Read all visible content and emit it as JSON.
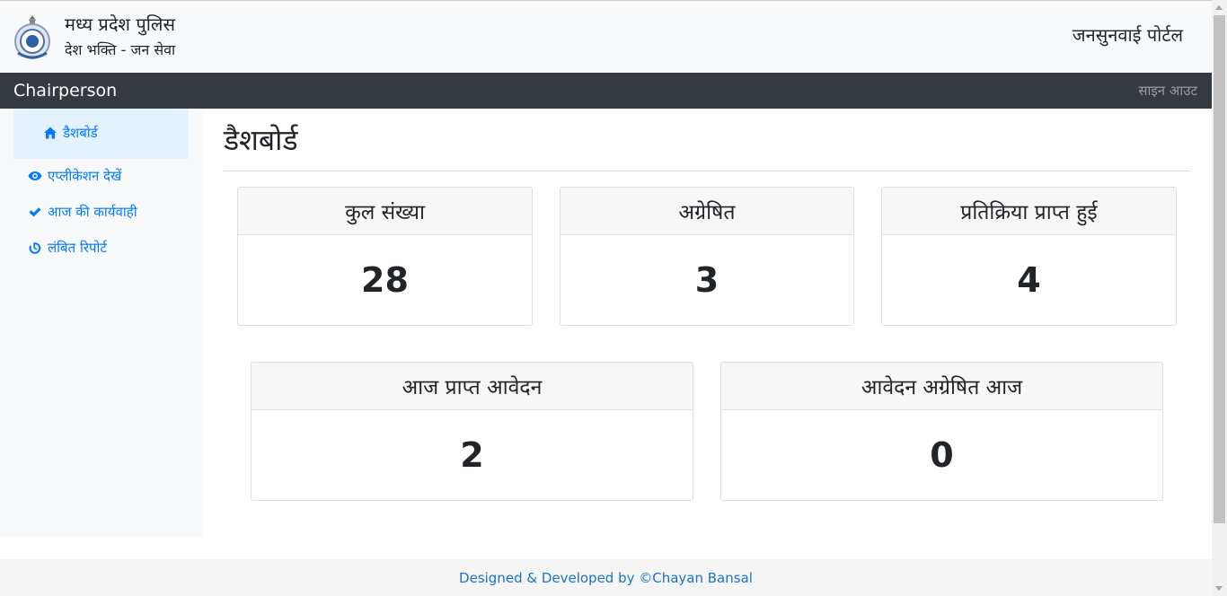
{
  "header": {
    "title": "मध्य प्रदेश पुलिस",
    "subtitle": "देश भक्ति - जन सेवा",
    "portal_name": "जनसुनवाई पोर्टल"
  },
  "navbar": {
    "role": "Chairperson",
    "signout": "साइन आउट"
  },
  "sidebar": {
    "items": [
      {
        "label": "डैशबोर्ड",
        "icon": "home-icon",
        "active": true
      },
      {
        "label": "एप्लीकेशन देखें",
        "icon": "eye-icon"
      },
      {
        "label": "आज की कार्यवाही",
        "icon": "check-icon"
      },
      {
        "label": "लंबित रिपोर्ट",
        "icon": "timer-icon"
      }
    ]
  },
  "main": {
    "title": "डैशबोर्ड",
    "cards": [
      {
        "label": "कुल संख्या",
        "value": "28"
      },
      {
        "label": "अग्रेषित",
        "value": "3"
      },
      {
        "label": "प्रतिक्रिया प्राप्त हुई",
        "value": "4"
      },
      {
        "label": "आज प्राप्त आवेदन",
        "value": "2"
      },
      {
        "label": "आवेदन अग्रेषित आज",
        "value": "0"
      }
    ]
  },
  "footer": {
    "credit": "Designed & Developed by ©Chayan Bansal"
  },
  "colors": {
    "navbar_bg": "#343a40",
    "link_blue": "#007bff",
    "active_bg": "#e3f2fd",
    "header_bg": "#f8f9fa"
  }
}
